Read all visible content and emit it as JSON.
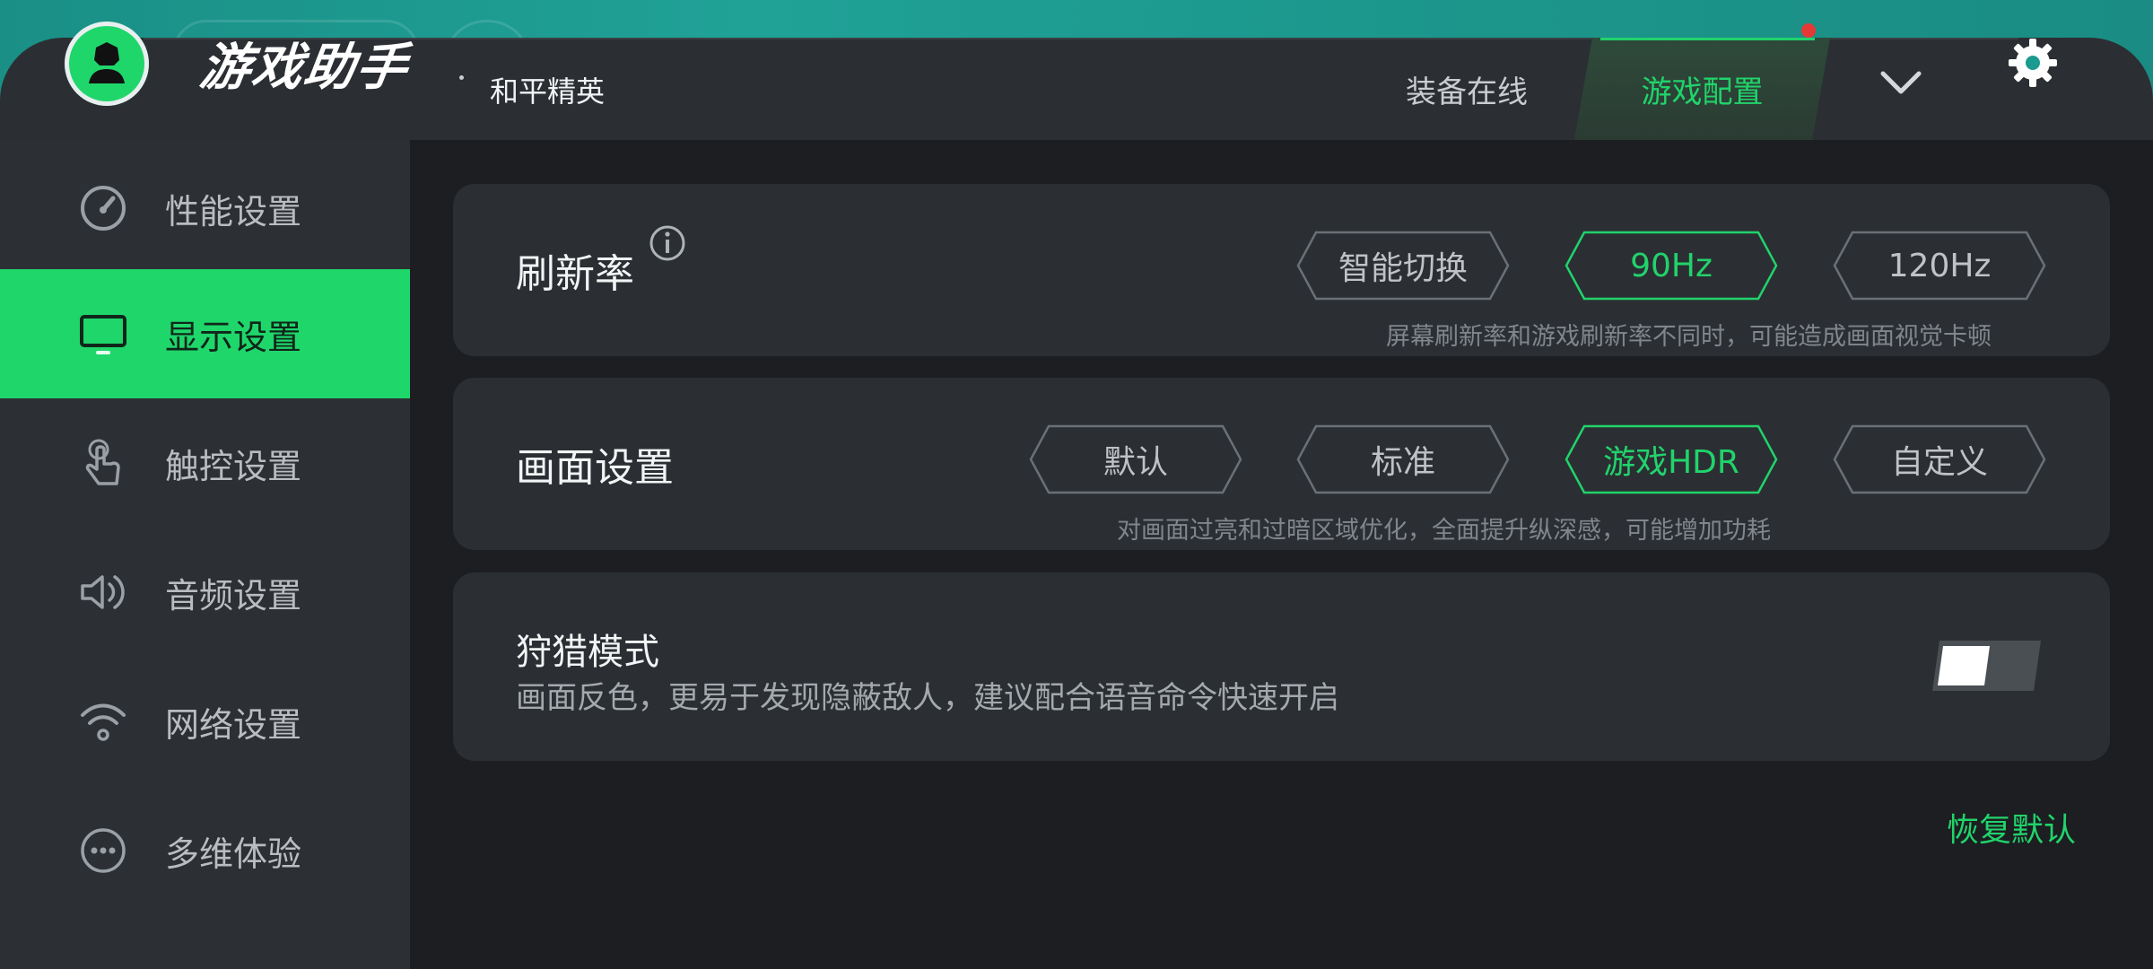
{
  "header": {
    "brand": "游戏助手",
    "separator": "·",
    "game_name": "和平精英",
    "tabs": [
      {
        "label": "装备在线",
        "active": false
      },
      {
        "label": "游戏配置",
        "active": true
      }
    ],
    "accent": "#1fd66b"
  },
  "sidebar": {
    "items": [
      {
        "label": "性能设置",
        "icon": "speedometer-icon",
        "active": false
      },
      {
        "label": "显示设置",
        "icon": "monitor-icon",
        "active": true
      },
      {
        "label": "触控设置",
        "icon": "touch-hand-icon",
        "active": false
      },
      {
        "label": "音频设置",
        "icon": "speaker-icon",
        "active": false
      },
      {
        "label": "网络设置",
        "icon": "wifi-icon",
        "active": false
      },
      {
        "label": "多维体验",
        "icon": "more-dots-icon",
        "active": false
      }
    ]
  },
  "refresh_rate": {
    "title": "刷新率",
    "options": [
      "智能切换",
      "90Hz",
      "120Hz"
    ],
    "selected": "90Hz",
    "hint": "屏幕刷新率和游戏刷新率不同时，可能造成画面视觉卡顿"
  },
  "picture": {
    "title": "画面设置",
    "options": [
      "默认",
      "标准",
      "游戏HDR",
      "自定义"
    ],
    "selected": "游戏HDR",
    "hint": "对画面过亮和过暗区域优化，全面提升纵深感，可能增加功耗"
  },
  "hunting": {
    "title": "狩猎模式",
    "description": "画面反色，更易于发现隐蔽敌人，建议配合语音命令快速开启",
    "enabled": false
  },
  "restore_label": "恢复默认"
}
